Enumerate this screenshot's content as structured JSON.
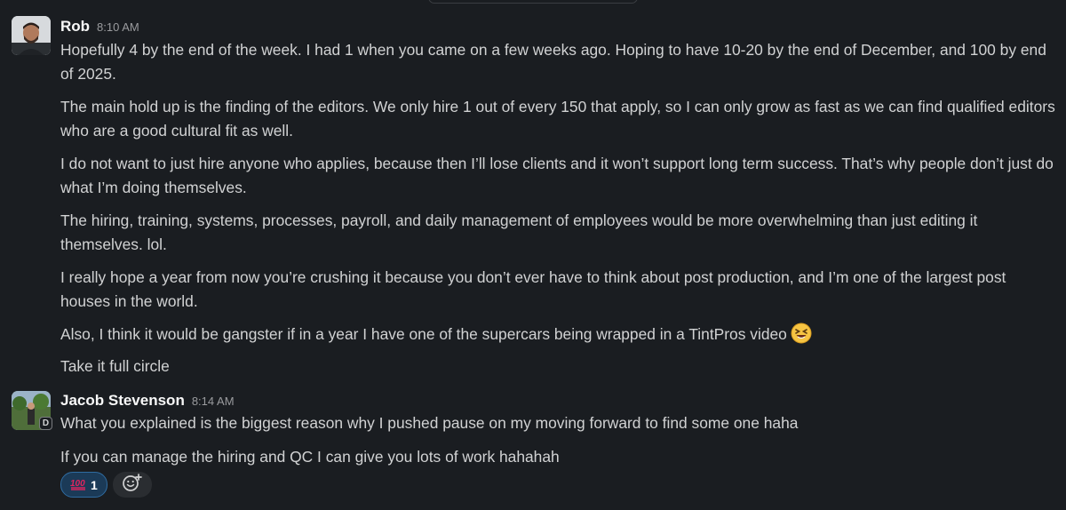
{
  "messages": [
    {
      "author": "Rob",
      "time": "8:10 AM",
      "lines": [
        "Hopefully 4 by the end of the week. I had 1 when you came on a few weeks ago. Hoping to have 10-20 by the end of December, and 100 by end of 2025.",
        "The main hold up is the finding of the editors. We only hire 1 out of every 150 that apply, so I can only grow as fast as we can find qualified editors who are a good cultural fit as well.",
        "I do not want to just hire anyone who applies, because then I’ll lose clients and it won’t support long term success. That’s why people don’t just do what I’m doing themselves.",
        "The hiring, training, systems, processes, payroll, and daily management of employees would be more overwhelming than just editing it themselves. lol.",
        "I really hope a year from now you’re crushing it because you don’t ever have to think about post production, and I’m one of the largest post houses in the world.",
        "Also, I think it would be gangster if in a year I have one of the supercars being wrapped in a TintPros video",
        "Take it full circle"
      ],
      "emoji": "laughing-squint-face-icon"
    },
    {
      "author": "Jacob Stevenson",
      "time": "8:14 AM",
      "avatar_badge": "D",
      "lines": [
        "What you explained is the biggest reason why I pushed pause on my moving forward to find some one haha",
        "If you can manage the hiring and QC I can give you lots of work hahahah"
      ],
      "reactions": [
        {
          "emoji": "100-icon",
          "count": "1"
        }
      ],
      "add_reaction_icon": "add-reaction-icon"
    }
  ],
  "colors": {
    "background": "#1a1d21",
    "text": "#d1d2d3",
    "reaction_bg": "#1b3a57",
    "reaction_border": "#2f6ca1"
  }
}
